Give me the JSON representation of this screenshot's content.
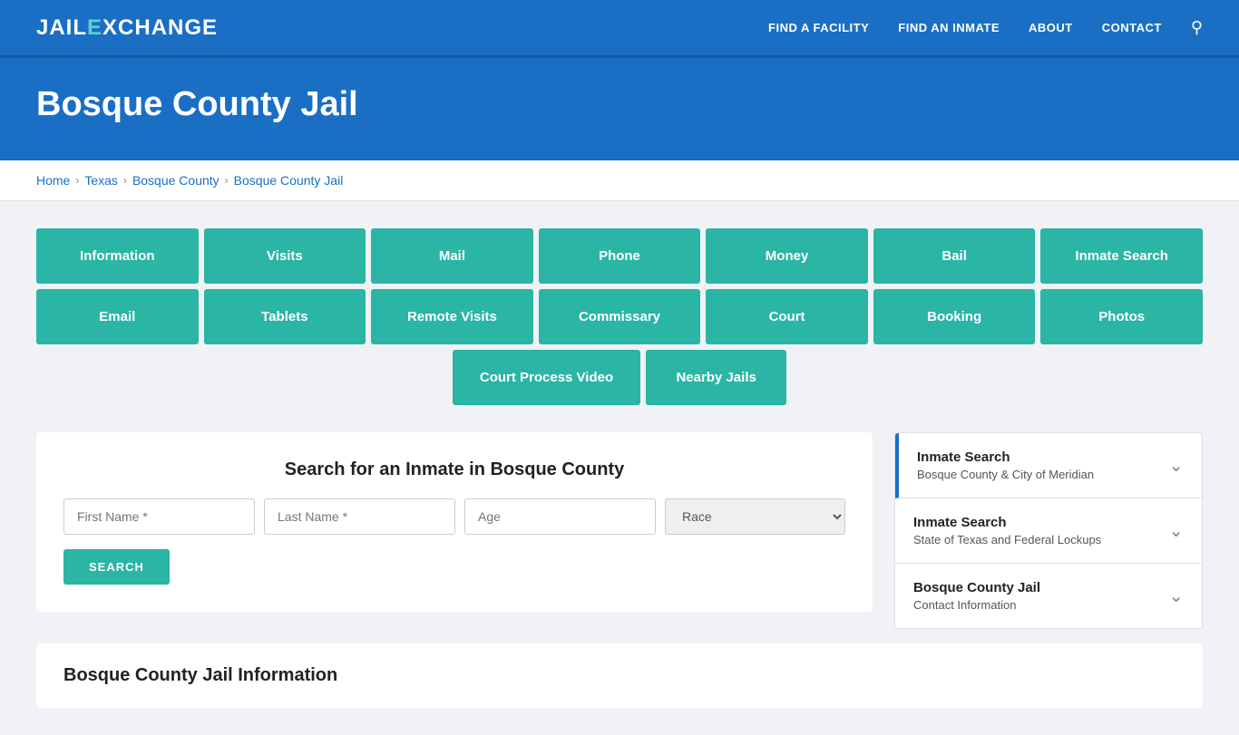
{
  "header": {
    "logo_jail": "JAIL",
    "logo_x": "E",
    "logo_exchange": "XCHANGE",
    "nav": [
      {
        "label": "FIND A FACILITY",
        "href": "#"
      },
      {
        "label": "FIND AN INMATE",
        "href": "#"
      },
      {
        "label": "ABOUT",
        "href": "#"
      },
      {
        "label": "CONTACT",
        "href": "#"
      }
    ]
  },
  "hero": {
    "title": "Bosque County Jail"
  },
  "breadcrumb": {
    "home": "Home",
    "texas": "Texas",
    "county": "Bosque County",
    "current": "Bosque County Jail"
  },
  "buttons_row1": [
    "Information",
    "Visits",
    "Mail",
    "Phone",
    "Money",
    "Bail",
    "Inmate Search"
  ],
  "buttons_row2": [
    "Email",
    "Tablets",
    "Remote Visits",
    "Commissary",
    "Court",
    "Booking",
    "Photos"
  ],
  "buttons_row3": [
    "Court Process Video",
    "Nearby Jails"
  ],
  "inmate_search": {
    "title": "Search for an Inmate in Bosque County",
    "first_name_placeholder": "First Name *",
    "last_name_placeholder": "Last Name *",
    "age_placeholder": "Age",
    "race_placeholder": "Race",
    "search_button": "SEARCH"
  },
  "sidebar": {
    "items": [
      {
        "title": "Inmate Search",
        "subtitle": "Bosque County & City of Meridian",
        "accent": true
      },
      {
        "title": "Inmate Search",
        "subtitle": "State of Texas and Federal Lockups",
        "accent": false
      },
      {
        "title": "Bosque County Jail",
        "subtitle": "Contact Information",
        "accent": false
      }
    ]
  },
  "bottom_section": {
    "title": "Bosque County Jail Information"
  }
}
